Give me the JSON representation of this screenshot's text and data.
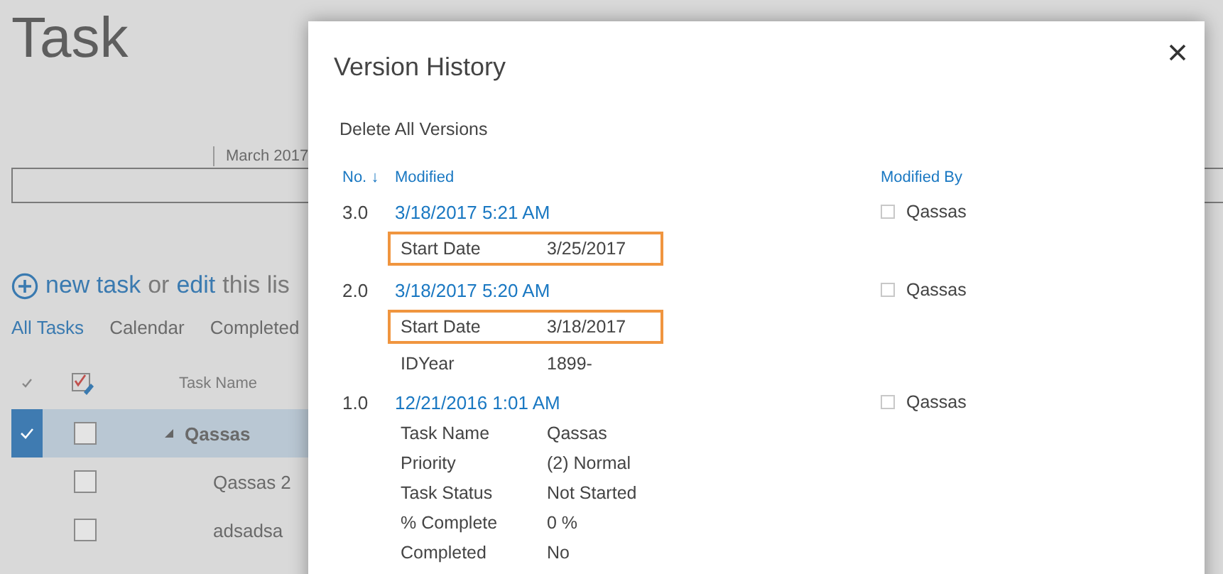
{
  "page": {
    "title": "Task",
    "timeline": {
      "label": "March 2017"
    },
    "actions": [
      {
        "text": "new task",
        "kind": "link"
      },
      {
        "text": "or",
        "kind": "plain"
      },
      {
        "text": "edit",
        "kind": "link"
      },
      {
        "text": "this lis",
        "kind": "plain"
      }
    ],
    "views": [
      {
        "label": "All Tasks",
        "selected": true
      },
      {
        "label": "Calendar",
        "selected": false
      },
      {
        "label": "Completed",
        "selected": false
      }
    ],
    "list": {
      "column": "Task Name",
      "rows": [
        {
          "name": "Qassas",
          "selected": true,
          "checked": false,
          "expanded": true
        },
        {
          "name": "Qassas 2",
          "selected": false,
          "checked": false
        },
        {
          "name": "adsadsa",
          "selected": false,
          "checked": false
        }
      ]
    }
  },
  "dialog": {
    "title": "Version History",
    "delete_action": "Delete All Versions",
    "columns": {
      "number": "No.",
      "sort_arrow": "↓",
      "modified": "Modified",
      "modified_by": "Modified By"
    },
    "versions": [
      {
        "number": "3.0",
        "modified": "3/18/2017 5:21 AM",
        "modified_by": "Qassas",
        "fields": [
          {
            "label": "Start Date",
            "value": "3/25/2017",
            "highlighted": true
          }
        ]
      },
      {
        "number": "2.0",
        "modified": "3/18/2017 5:20 AM",
        "modified_by": "Qassas",
        "fields": [
          {
            "label": "Start Date",
            "value": "3/18/2017",
            "highlighted": true
          },
          {
            "label": "IDYear",
            "value": "1899-",
            "highlighted": false
          }
        ]
      },
      {
        "number": "1.0",
        "modified": "12/21/2016 1:01 AM",
        "modified_by": "Qassas",
        "fields": [
          {
            "label": "Task Name",
            "value": "Qassas",
            "highlighted": false
          },
          {
            "label": "Priority",
            "value": "(2) Normal",
            "highlighted": false
          },
          {
            "label": "Task Status",
            "value": "Not Started",
            "highlighted": false
          },
          {
            "label": "% Complete",
            "value": "0 %",
            "highlighted": false
          },
          {
            "label": "Completed",
            "value": "No",
            "highlighted": false
          }
        ]
      }
    ]
  }
}
